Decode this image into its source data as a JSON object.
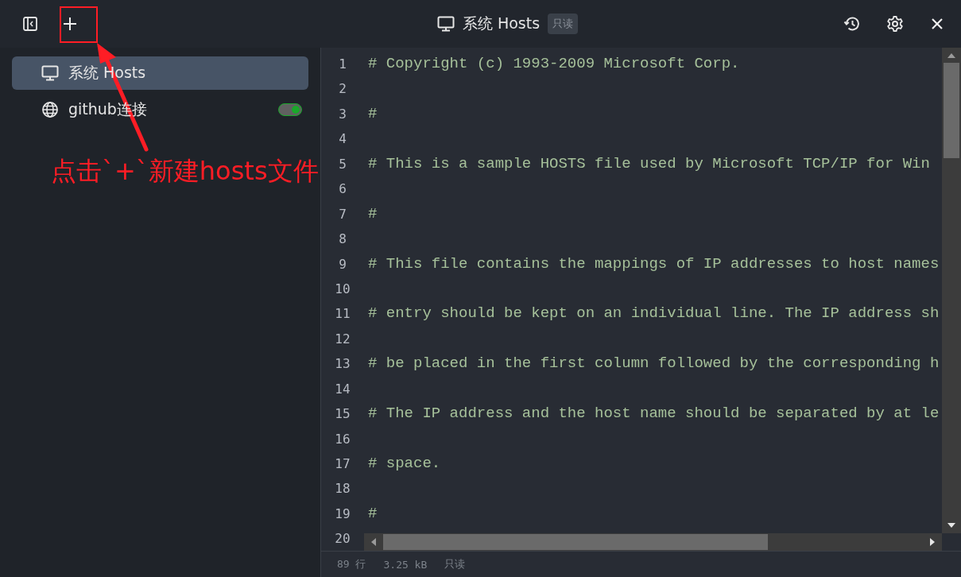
{
  "toolbar": {
    "title": "系统 Hosts",
    "badge": "只读"
  },
  "sidebar": {
    "items": [
      {
        "label": "系统 Hosts",
        "kind": "system",
        "selected": true
      },
      {
        "label": "github连接",
        "kind": "remote",
        "selected": false,
        "on": true
      }
    ]
  },
  "editor": {
    "lines": [
      {
        "number": "1",
        "text": "# Copyright (c) 1993-2009 Microsoft Corp."
      },
      {
        "number": "2"
      },
      {
        "number": "3",
        "text": "#"
      },
      {
        "number": "4"
      },
      {
        "number": "5",
        "text": "# This is a sample HOSTS file used by Microsoft TCP/IP for Win"
      },
      {
        "number": "6"
      },
      {
        "number": "7",
        "text": "#"
      },
      {
        "number": "8"
      },
      {
        "number": "9",
        "text": "# This file contains the mappings of IP addresses to host names"
      },
      {
        "number": "10"
      },
      {
        "number": "11",
        "text": "# entry should be kept on an individual line. The IP address sh"
      },
      {
        "number": "12"
      },
      {
        "number": "13",
        "text": "# be placed in the first column followed by the corresponding h"
      },
      {
        "number": "14"
      },
      {
        "number": "15",
        "text": "# The IP address and the host name should be separated by at le"
      },
      {
        "number": "16"
      },
      {
        "number": "17",
        "text": "# space."
      },
      {
        "number": "18"
      },
      {
        "number": "19",
        "text": "#"
      },
      {
        "number": "20"
      }
    ]
  },
  "status_bar": {
    "lines": "89 行",
    "size": "3.25 kB",
    "mode": "只读"
  },
  "annotation": {
    "text": "点击`+`新建hosts文件"
  }
}
